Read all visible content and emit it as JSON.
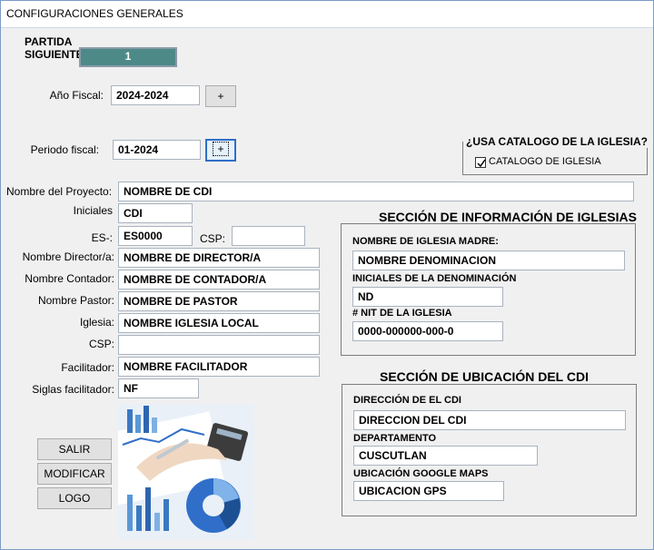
{
  "window": {
    "title": "CONFIGURACIONES GENERALES"
  },
  "partida": {
    "label_line1": "PARTIDA",
    "label_line2": "SIGUIENTE",
    "value": "1"
  },
  "anio_fiscal": {
    "label": "Año Fiscal:",
    "value": "2024-2024",
    "button": "+"
  },
  "periodo_fiscal": {
    "label": "Periodo fiscal:",
    "value": "01-2024",
    "button": "+"
  },
  "catalogo": {
    "group_title": "¿USA CATALOGO DE LA IGLESIA?",
    "checkbox_label": "CATALOGO DE IGLESIA",
    "checked": true
  },
  "form": {
    "nombre_proyecto": {
      "label": "Nombre del Proyecto:",
      "value": "NOMBRE DE CDI"
    },
    "iniciales": {
      "label": "Iniciales",
      "value": "CDI"
    },
    "es": {
      "label": "ES-:",
      "value": "ES0000"
    },
    "csp_top": {
      "label": "CSP:",
      "value": ""
    },
    "director": {
      "label": "Nombre Director/a:",
      "value": "NOMBRE DE DIRECTOR/A"
    },
    "contador": {
      "label": "Nombre Contador:",
      "value": "NOMBRE DE CONTADOR/A"
    },
    "pastor": {
      "label": "Nombre Pastor:",
      "value": "NOMBRE DE PASTOR"
    },
    "iglesia": {
      "label": "Iglesia:",
      "value": "NOMBRE IGLESIA LOCAL"
    },
    "csp": {
      "label": "CSP:",
      "value": ""
    },
    "facilitador": {
      "label": "Facilitador:",
      "value": "NOMBRE FACILITADOR"
    },
    "siglas_facilitador": {
      "label": "Siglas facilitador:",
      "value": "NF"
    }
  },
  "buttons": {
    "salir": "SALIR",
    "modificar": "MODIFICAR",
    "logo": "LOGO"
  },
  "seccion_iglesias": {
    "title": "SECCIÓN DE INFORMACIÓN DE IGLESIAS",
    "madre": {
      "label": "NOMBRE DE IGLESIA MADRE:",
      "value": "NOMBRE DENOMINACION"
    },
    "iniciales": {
      "label": "INICIALES DE LA DENOMINACIÓN",
      "value": "ND"
    },
    "nit": {
      "label": "# NIT DE LA IGLESIA",
      "value": "0000-000000-000-0"
    }
  },
  "seccion_ubicacion": {
    "title": "SECCIÓN DE UBICACIÓN DEL CDI",
    "direccion": {
      "label": "DIRECCIÓN DE EL CDI",
      "value": "DIRECCION DEL CDI"
    },
    "departamento": {
      "label": "DEPARTAMENTO",
      "value": "CUSCUTLAN"
    },
    "maps": {
      "label": "UBICACIÓN GOOGLE MAPS",
      "value": "UBICACION GPS"
    }
  },
  "colors": {
    "teal": "#4d8a87",
    "window_bg": "#f0f0f0",
    "accent_blue": "#2f6fc9"
  },
  "icons": {
    "checkbox": "checkmark-icon",
    "photo": "business-charts-image"
  }
}
